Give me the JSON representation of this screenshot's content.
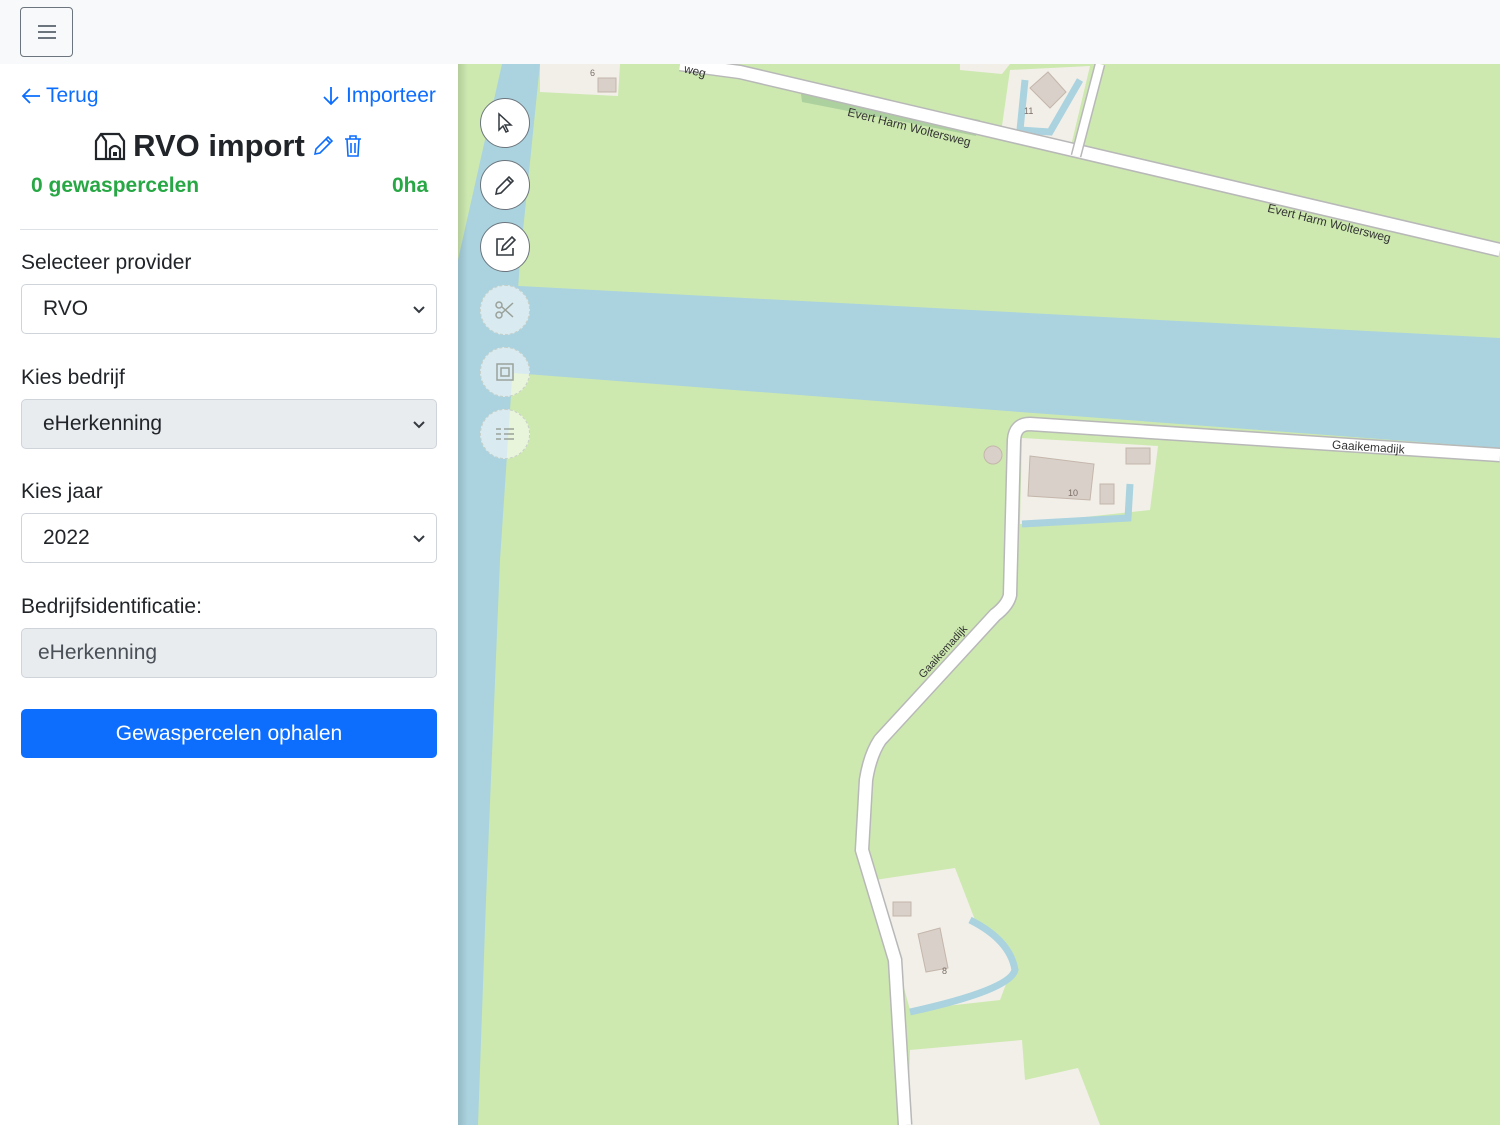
{
  "topbar": {
    "menu_icon": "hamburger-icon"
  },
  "sidebar": {
    "back_label": "Terug",
    "import_label": "Importeer",
    "title": "RVO import",
    "parcel_count": "0 gewaspercelen",
    "area": "0ha",
    "provider": {
      "label": "Selecteer provider",
      "value": "RVO"
    },
    "company": {
      "label": "Kies bedrijf",
      "value": "eHerkenning"
    },
    "year": {
      "label": "Kies jaar",
      "value": "2022"
    },
    "identification": {
      "label": "Bedrijfsidentificatie:",
      "value": "eHerkenning"
    },
    "fetch_button": "Gewaspercelen ophalen"
  },
  "map": {
    "street_labels": [
      "Evert Harm Woltersweg",
      "Evert Harm Woltersweg",
      "Gaaikemadijk",
      "Gaaikemadijk",
      "weg"
    ],
    "house_numbers": [
      "6",
      "11",
      "10",
      "8"
    ],
    "tools": [
      "select-pointer-icon",
      "draw-pencil-icon",
      "edit-icon",
      "cut-scissors-icon",
      "merge-polygon-icon",
      "list-icon"
    ],
    "colors": {
      "grass": "#cde9b0",
      "water": "#aad3df",
      "road": "#ffffff",
      "building": "#d9d0c9",
      "residential": "#f2efe9"
    }
  }
}
